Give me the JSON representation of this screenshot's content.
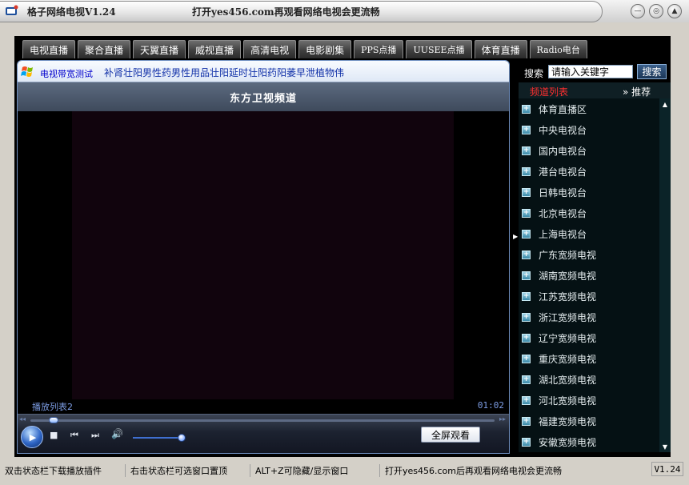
{
  "window": {
    "title": "格子网络电视V1.24",
    "slogan": "打开yes456.com再观看网络电视会更流畅",
    "minimize_glyph": "—",
    "restore_glyph": "◎",
    "close_glyph": "▲"
  },
  "tabs": [
    {
      "label": "电视直播"
    },
    {
      "label": "聚合直播"
    },
    {
      "label": "天翼直播"
    },
    {
      "label": "威视直播"
    },
    {
      "label": "高清电视"
    },
    {
      "label": "电影剧集"
    },
    {
      "label": "PPS点播"
    },
    {
      "label": "UUSEE点播"
    },
    {
      "label": "体育直播"
    },
    {
      "label": "Radio电台"
    }
  ],
  "player": {
    "bandwidth_link": "电视带宽测试",
    "ad_text": "补肾壮阳男性药男性用品壮阳延时壮阳药阳萎早泄植物伟",
    "channel_title": "东方卫视频道",
    "playlist_label": "播放列表2",
    "time": "01:02",
    "seek_progress": 0.04,
    "volume_level": 0.95,
    "fullscreen_label": "全屏观看",
    "seek_back_glyph": "◂◂",
    "seek_fwd_glyph": "▸▸",
    "play_glyph": "▶",
    "stop_glyph": "■",
    "prev_glyph": "⏮",
    "next_glyph": "⏭",
    "volume_glyph": "🔊"
  },
  "sidebar": {
    "search_label": "搜索",
    "search_placeholder": "请输入关键字",
    "search_button": "搜索",
    "list_title": "频道列表",
    "recommend_label": "» 推荐",
    "scroll_up_glyph": "▲",
    "scroll_down_glyph": "▼",
    "split_arrow_glyph": "▶",
    "item_glyph": "+",
    "channels": [
      {
        "label": "体育直播区"
      },
      {
        "label": "中央电视台"
      },
      {
        "label": "国内电视台"
      },
      {
        "label": "港台电视台"
      },
      {
        "label": "日韩电视台"
      },
      {
        "label": "北京电视台"
      },
      {
        "label": "上海电视台"
      },
      {
        "label": "广东宽频电视"
      },
      {
        "label": "湖南宽频电视"
      },
      {
        "label": "江苏宽频电视"
      },
      {
        "label": "浙江宽频电视"
      },
      {
        "label": "辽宁宽频电视"
      },
      {
        "label": "重庆宽频电视"
      },
      {
        "label": "湖北宽频电视"
      },
      {
        "label": "河北宽频电视"
      },
      {
        "label": "福建宽频电视"
      },
      {
        "label": "安徽宽频电视"
      }
    ]
  },
  "statusbar": {
    "tip1": "双击状态栏下载播放插件",
    "tip2": "右击状态栏可选窗口置顶",
    "tip3": "ALT+Z可隐藏/显示窗口",
    "tip4": "打开yes456.com后再观看网络电视会更流畅",
    "version": "V1.24"
  }
}
